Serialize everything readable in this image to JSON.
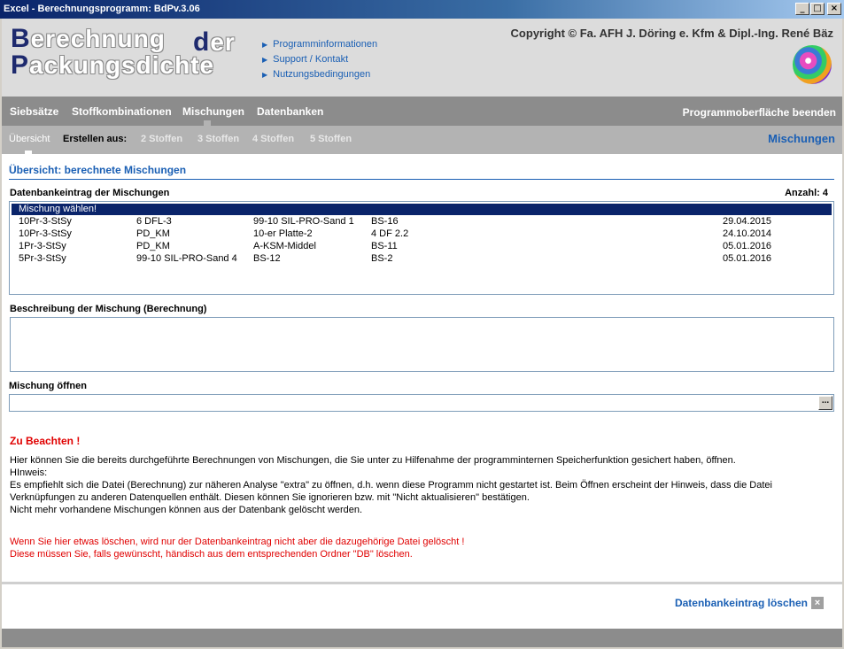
{
  "window": {
    "title": "Excel - Berechnungsprogramm: BdPv.3.06",
    "minimize": "_",
    "maximize": "□",
    "close": "×"
  },
  "header": {
    "logo": {
      "line1_cap": "B",
      "line1_rest": "erechnung",
      "der_cap": "d",
      "der_rest": "er",
      "line2_cap": "P",
      "line2_rest": "ackungsdichte"
    },
    "links": [
      "Programminformationen",
      "Support / Kontakt",
      "Nutzungsbedingungen"
    ],
    "copyright": "Copyright © Fa. AFH J. Döring e. Kfm & Dipl.-Ing. René Bäz"
  },
  "mainnav": {
    "items": [
      "Siebsätze",
      "Stoffkombinationen",
      "Mischungen",
      "Datenbanken"
    ],
    "quit": "Programmoberfläche beenden"
  },
  "subnav": {
    "overview": "Übersicht",
    "create_label": "Erstellen aus:",
    "options": [
      "2 Stoffen",
      "3 Stoffen",
      "4 Stoffen",
      "5 Stoffen"
    ],
    "section": "Mischungen"
  },
  "content": {
    "title": "Übersicht: berechnete Mischungen",
    "db_label": "Datenbankeintrag der Mischungen",
    "count_label": "Anzahl: 4",
    "list": {
      "header": "Mischung wählen!",
      "rows": [
        {
          "name": "10Pr-3-StSy",
          "c1": "6 DFL-3",
          "c2": "99-10 SIL-PRO-Sand 1",
          "c3": "BS-16",
          "date": "29.04.2015"
        },
        {
          "name": "10Pr-3-StSy",
          "c1": "PD_KM",
          "c2": "10-er Platte-2",
          "c3": "4 DF 2.2",
          "date": "24.10.2014"
        },
        {
          "name": "1Pr-3-StSy",
          "c1": "PD_KM",
          "c2": "A-KSM-Middel",
          "c3": "BS-11",
          "date": "05.01.2016"
        },
        {
          "name": "5Pr-3-StSy",
          "c1": "99-10 SIL-PRO-Sand 4",
          "c2": "BS-12",
          "c3": "BS-2",
          "date": "05.01.2016"
        }
      ]
    },
    "description_label": "Beschreibung der Mischung (Berechnung)",
    "description_value": "",
    "open_label": "Mischung öffnen",
    "open_value": "",
    "browse_label": "...",
    "warning_heading": "Zu Beachten !",
    "notes": [
      "Hier können Sie die bereits durchgeführte Berechnungen von Mischungen, die Sie unter zu Hilfenahme der programminternen Speicherfunktion gesichert haben, öffnen.",
      "HInweis:",
      "Es empfiehlt sich die Datei (Berechnung) zur näheren Analyse \"extra\" zu öffnen, d.h. wenn diese Programm nicht gestartet ist. Beim Öffnen erscheint der Hinweis, dass die Datei",
      "Verknüpfungen zu anderen Datenquellen enthält. Diesen können Sie ignorieren bzw. mit \"Nicht aktualisieren\" bestätigen.",
      "Nicht mehr vorhandene Mischungen können aus der Datenbank gelöscht werden."
    ],
    "red_notes": [
      "Wenn Sie hier etwas löschen, wird nur der Datenbankeintrag nicht aber die dazugehörige Datei gelöscht !",
      "Diese müssen Sie, falls gewünscht, händisch aus dem entsprechenden Ordner \"DB\" löschen."
    ],
    "delete_label": "Datenbankeintrag löschen",
    "delete_icon": "×"
  },
  "colors": {
    "accent": "#1a5fb4",
    "nav_gray": "#8c8c8c",
    "warning": "#e00000",
    "selection": "#0a246a"
  }
}
